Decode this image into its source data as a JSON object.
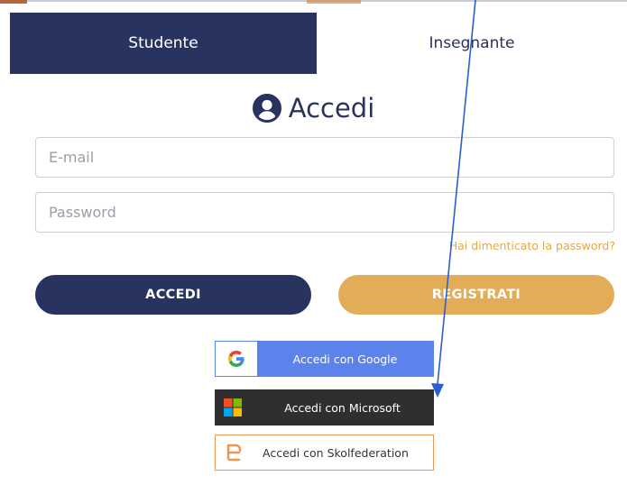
{
  "tabs": {
    "student": "Studente",
    "teacher": "Insegnante"
  },
  "title": "Accedi",
  "form": {
    "email_placeholder": "E-mail",
    "password_placeholder": "Password",
    "forgot": "Hai dimenticato la password?"
  },
  "buttons": {
    "login": "ACCEDI",
    "register": "REGISTRATI"
  },
  "social": {
    "google": "Accedi con Google",
    "microsoft": "Accedi con Microsoft",
    "skolfederation": "Accedi con Skolfederation"
  },
  "colors": {
    "navy": "#293360",
    "gold": "#e2ad56",
    "google_blue": "#5c83ec",
    "microsoft_dark": "#2f2f2f",
    "skol_orange": "#e89756",
    "annotation_arrow": "#2b5fd0"
  },
  "icons": {
    "title": "user-circle-icon",
    "google": "google-logo-icon",
    "microsoft": "microsoft-logo-icon",
    "skolfederation": "skolfederation-logo-icon",
    "annotation": "arrow-icon"
  }
}
